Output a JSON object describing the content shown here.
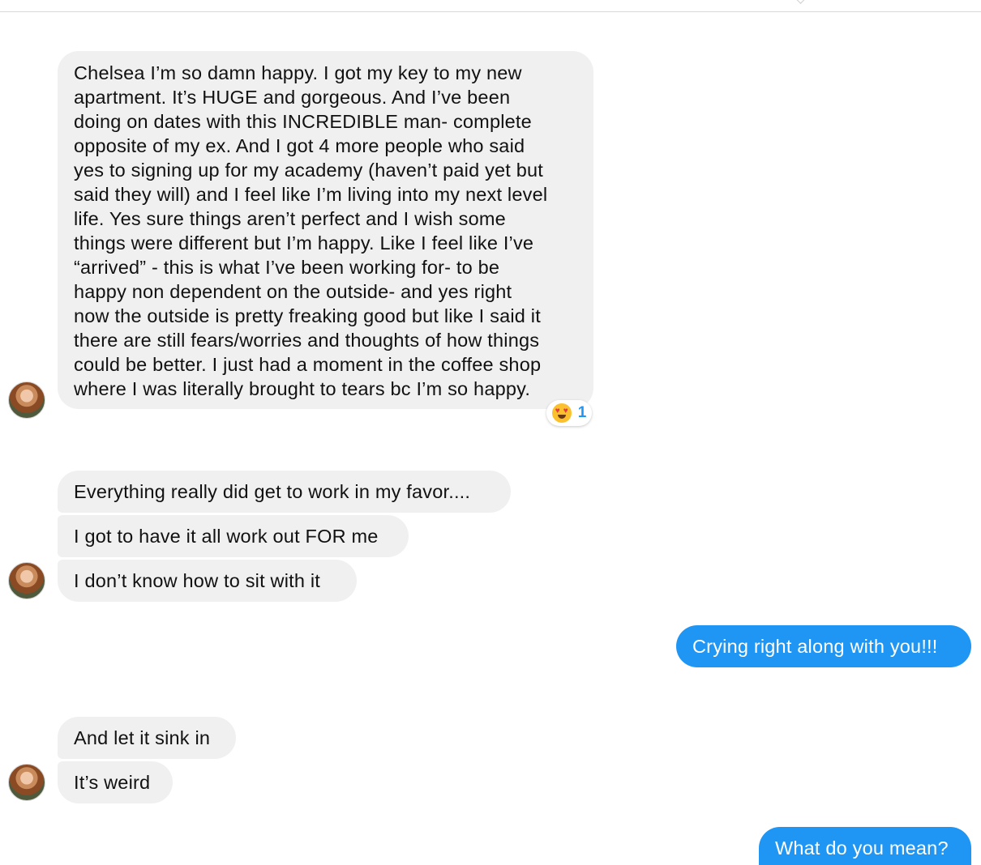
{
  "messages": {
    "m1": "Chelsea I’m so damn happy. I got my key to my new\napartment. It’s HUGE and gorgeous. And I’ve been\ndoing on dates with this INCREDIBLE man- complete\nopposite of my ex. And I got 4 more people who said\nyes to signing up for my academy (haven’t paid yet but\nsaid they will) and I feel like I’m living into my next level\nlife. Yes sure things aren’t perfect and I wish some\nthings were different but I’m happy. Like I feel like I’ve\n“arrived” - this is what I’ve been working for- to be\nhappy non dependent on the outside- and yes right\nnow the outside is pretty freaking good but like I said it\nthere are still fears/worries and thoughts of how things\ncould be better. I just had a moment in the coffee shop\nwhere I was literally brought to tears bc I’m so happy.",
    "m2": "Everything really did get to work in my favor....",
    "m3": "I got to have it all work out FOR me",
    "m4": "I don’t know how to sit with it",
    "m5": "Crying right along with you!!!",
    "m6": "And let it sink in",
    "m7": "It’s weird",
    "m8": "What do you mean?"
  },
  "reaction": {
    "icon": "heart-eyes-emoji-icon",
    "count": "1"
  },
  "colors": {
    "incoming_bubble": "#f0f0f0",
    "outgoing_bubble": "#1f96f3",
    "reaction_count": "#1f96f3"
  }
}
